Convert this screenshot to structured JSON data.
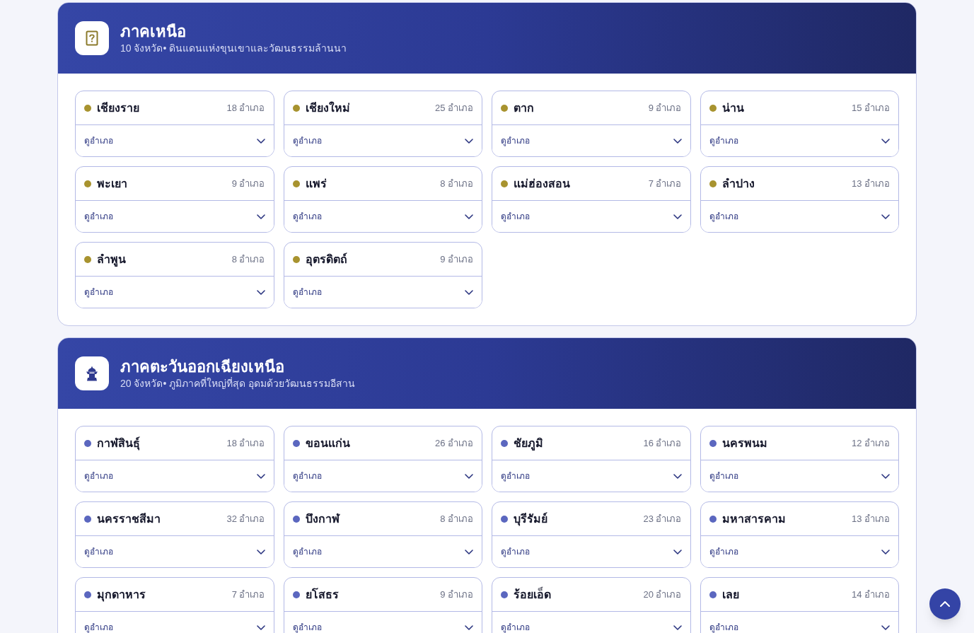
{
  "regions": [
    {
      "title": "ภาคเหนือ",
      "subtitle": "10 จังหวัด• ดินแดนแห่งขุนเขาและวัฒนธรรมล้านนา",
      "color": "#a8932f",
      "provinces": [
        {
          "name": "เชียงราย",
          "count": "18 อำเภอ",
          "link": "ดูอำเภอ",
          "expanded": false
        },
        {
          "name": "เชียงใหม่",
          "count": "25 อำเภอ",
          "link": "ดูอำเภอ",
          "expanded": false
        },
        {
          "name": "ตาก",
          "count": "9 อำเภอ",
          "link": "ดูอำเภอ",
          "expanded": false
        },
        {
          "name": "น่าน",
          "count": "15 อำเภอ",
          "link": "ดูอำเภอ",
          "expanded": false
        },
        {
          "name": "พะเยา",
          "count": "9 อำเภอ",
          "link": "ดูอำเภอ",
          "expanded": false
        },
        {
          "name": "แพร่",
          "count": "8 อำเภอ",
          "link": "ดูอำเภอ",
          "expanded": false
        },
        {
          "name": "แม่ฮ่องสอน",
          "count": "7 อำเภอ",
          "link": "ดูอำเภอ",
          "expanded": false
        },
        {
          "name": "ลำปาง",
          "count": "13 อำเภอ",
          "link": "ดูอำเภอ",
          "expanded": false
        },
        {
          "name": "ลำพูน",
          "count": "8 อำเภอ",
          "link": "ดูอำเภอ",
          "expanded": false
        },
        {
          "name": "อุตรดิตถ์",
          "count": "9 อำเภอ",
          "link": "ดูอำเภอ",
          "expanded": false
        }
      ]
    },
    {
      "title": "ภาคตะวันออกเฉียงเหนือ",
      "subtitle": "20 จังหวัด• ภูมิภาคที่ใหญ่ที่สุด อุดมด้วยวัฒนธรรมอีสาน",
      "color": "#5b67bf",
      "provinces": [
        {
          "name": "กาฬสินธุ์",
          "count": "18 อำเภอ",
          "link": "ดูอำเภอ",
          "expanded": false
        },
        {
          "name": "ขอนแก่น",
          "count": "26 อำเภอ",
          "link": "ดูอำเภอ",
          "expanded": false
        },
        {
          "name": "ชัยภูมิ",
          "count": "16 อำเภอ",
          "link": "ดูอำเภอ",
          "expanded": false
        },
        {
          "name": "นครพนม",
          "count": "12 อำเภอ",
          "link": "ดูอำเภอ",
          "expanded": false
        },
        {
          "name": "นครราชสีมา",
          "count": "32 อำเภอ",
          "link": "ดูอำเภอ",
          "expanded": false
        },
        {
          "name": "บึงกาฬ",
          "count": "8 อำเภอ",
          "link": "ดูอำเภอ",
          "expanded": false
        },
        {
          "name": "บุรีรัมย์",
          "count": "23 อำเภอ",
          "link": "ดูอำเภอ",
          "expanded": false
        },
        {
          "name": "มหาสารคาม",
          "count": "13 อำเภอ",
          "link": "ดูอำเภอ",
          "expanded": false
        },
        {
          "name": "มุกดาหาร",
          "count": "7 อำเภอ",
          "link": "ดูอำเภอ",
          "expanded": false
        },
        {
          "name": "ยโสธร",
          "count": "9 อำเภอ",
          "link": "ดูอำเภอ",
          "expanded": false
        },
        {
          "name": "ร้อยเอ็ด",
          "count": "20 อำเภอ",
          "link": "ดูอำเภอ",
          "expanded": false
        },
        {
          "name": "เลย",
          "count": "14 อำเภอ",
          "link": "ดูอำเภอ",
          "expanded": false
        }
      ]
    }
  ]
}
